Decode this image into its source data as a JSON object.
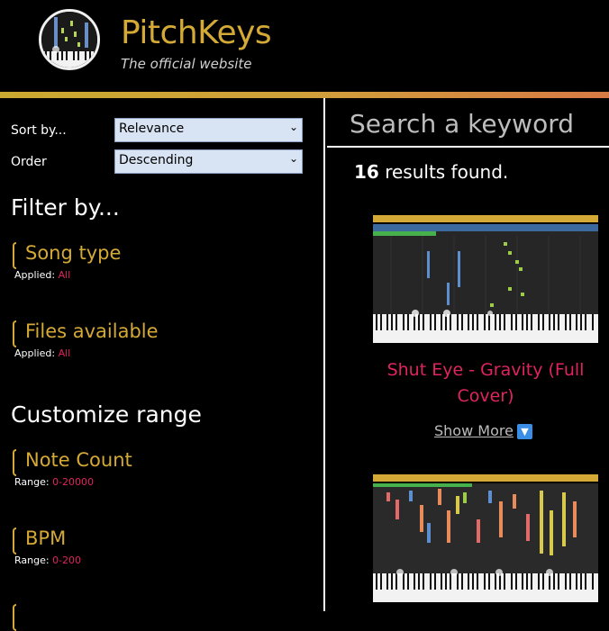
{
  "header": {
    "title": "PitchKeys",
    "subtitle": "The official website"
  },
  "sidebar": {
    "sort_label": "Sort by...",
    "sort_value": "Relevance",
    "order_label": "Order",
    "order_value": "Descending",
    "filter_heading": "Filter by...",
    "filters": [
      {
        "title": "Song type",
        "applied_label": "Applied:",
        "applied_value": "All"
      },
      {
        "title": "Files available",
        "applied_label": "Applied:",
        "applied_value": "All"
      }
    ],
    "range_heading": "Customize range",
    "ranges": [
      {
        "title": "Note Count",
        "range_label": "Range:",
        "range_value": "0-20000"
      },
      {
        "title": "BPM",
        "range_label": "Range:",
        "range_value": "0-200"
      }
    ]
  },
  "main": {
    "search_placeholder": "Search a keyword",
    "results_count": "16",
    "results_suffix": " results found.",
    "cards": [
      {
        "title": "Shut Eye - Gravity (Full Cover)",
        "show_more": "Show More"
      },
      {
        "title": ""
      }
    ]
  },
  "colors": {
    "accent_gold": "#d4a935",
    "title_pink": "#e0245e",
    "select_bg": "#d8e4f4"
  },
  "icons": {
    "select_arrow": "chevron-down-icon",
    "show_more_arrow": "arrow-down-icon"
  }
}
